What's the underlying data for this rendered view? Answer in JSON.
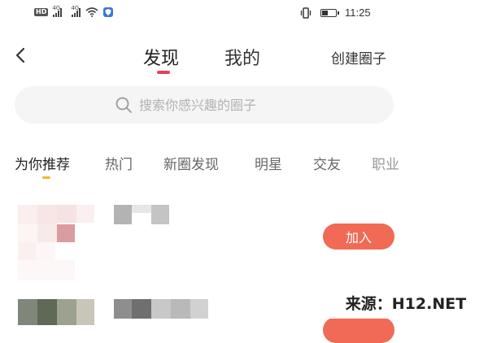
{
  "status_bar": {
    "hd_badge": "HD",
    "network_1": "4G",
    "network_2": "4G",
    "time": "11:25",
    "battery_level": 0.45,
    "icons": [
      "hd-badge",
      "signal-icon",
      "signal-icon",
      "wifi-icon",
      "shield-icon",
      "vibrate-icon",
      "battery-icon"
    ]
  },
  "header": {
    "tabs": [
      {
        "label": "发现",
        "active": true
      },
      {
        "label": "我的",
        "active": false
      }
    ],
    "create_label": "创建圈子",
    "accent_color": "#e8405b"
  },
  "search": {
    "placeholder": "搜索你感兴趣的圈子"
  },
  "categories": [
    {
      "label": "为你推荐",
      "active": true
    },
    {
      "label": "热门",
      "active": false
    },
    {
      "label": "新圈发现",
      "active": false
    },
    {
      "label": "明星",
      "active": false
    },
    {
      "label": "交友",
      "active": false
    },
    {
      "label": "职业",
      "active": false
    }
  ],
  "circle_list": {
    "join_label": "加入",
    "button_color": "#f06a55"
  },
  "watermark": {
    "text": "来源：H12.NET"
  }
}
